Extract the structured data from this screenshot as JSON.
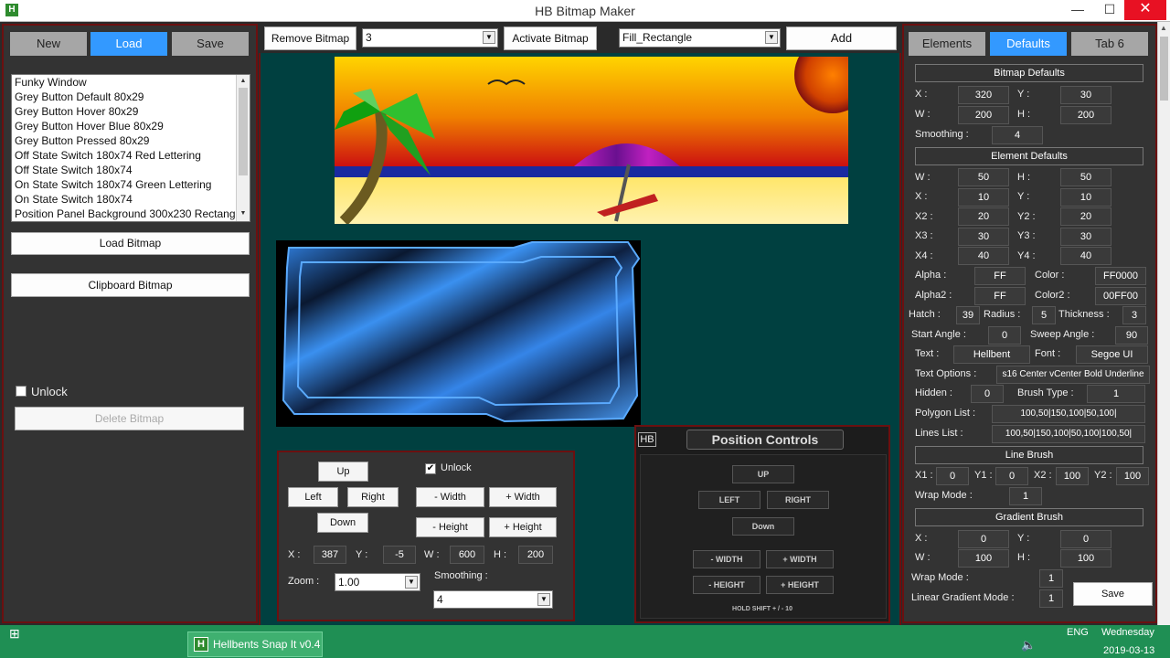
{
  "window": {
    "title": "HB Bitmap Maker",
    "app_icon": "H",
    "minimize": "—",
    "maximize": "☐",
    "close": "✕"
  },
  "toolbar_left": {
    "new": "New",
    "load": "Load",
    "save": "Save"
  },
  "bitmap_list": [
    "Funky Window",
    "Grey Button Default 80x29",
    "Grey Button Hover 80x29",
    "Grey Button Hover Blue 80x29",
    "Grey Button Pressed 80x29",
    "Off State Switch 180x74 Red Lettering",
    "Off State Switch 180x74",
    "On State Switch 180x74 Green Lettering",
    "On State Switch 180x74",
    "Position Panel Background 300x230 Rectang"
  ],
  "left_panel": {
    "load_bitmap": "Load Bitmap",
    "clipboard_bitmap": "Clipboard Bitmap",
    "unlock": "Unlock",
    "delete_bitmap": "Delete Bitmap"
  },
  "top_bar": {
    "remove_bitmap": "Remove Bitmap",
    "index_value": "3",
    "activate_bitmap": "Activate Bitmap",
    "element_type": "Fill_Rectangle",
    "add": "Add"
  },
  "controls": {
    "up": "Up",
    "left": "Left",
    "right": "Right",
    "down": "Down",
    "unlock": "Unlock",
    "minus_width": "- Width",
    "plus_width": "+ Width",
    "minus_height": "- Height",
    "plus_height": "+ Height",
    "x_label": "X :",
    "x": "387",
    "y_label": "Y :",
    "y": "-5",
    "w_label": "W :",
    "w": "600",
    "h_label": "H :",
    "h": "200",
    "zoom_label": "Zoom :",
    "zoom": "1.00",
    "smoothing_label": "Smoothing :",
    "smoothing": "4"
  },
  "position_controls": {
    "hb": "HB",
    "title": "Position Controls",
    "up": "UP",
    "left": "LEFT",
    "right": "RIGHT",
    "down": "Down",
    "minus_width": "- WIDTH",
    "plus_width": "+ WIDTH",
    "minus_height": "- HEIGHT",
    "plus_height": "+ HEIGHT",
    "hint": "HOLD SHIFT + / - 10"
  },
  "right_tabs": {
    "elements": "Elements",
    "defaults": "Defaults",
    "tab6": "Tab 6"
  },
  "defaults": {
    "bitmap_defaults": "Bitmap Defaults",
    "bx_l": "X :",
    "bx": "320",
    "by_l": "Y :",
    "by": "30",
    "bw_l": "W :",
    "bw": "200",
    "bh_l": "H :",
    "bh": "200",
    "smooth_l": "Smoothing :",
    "smooth": "4",
    "element_defaults": "Element Defaults",
    "ew_l": "W :",
    "ew": "50",
    "eh_l": "H :",
    "eh": "50",
    "ex_l": "X :",
    "ex": "10",
    "ey_l": "Y :",
    "ey": "10",
    "x2_l": "X2 :",
    "x2": "20",
    "y2_l": "Y2 :",
    "y2": "20",
    "x3_l": "X3 :",
    "x3": "30",
    "y3_l": "Y3 :",
    "y3": "30",
    "x4_l": "X4 :",
    "x4": "40",
    "y4_l": "Y4 :",
    "y4": "40",
    "alpha_l": "Alpha :",
    "alpha": "FF",
    "color_l": "Color :",
    "color": "FF0000",
    "alpha2_l": "Alpha2 :",
    "alpha2": "FF",
    "color2_l": "Color2 :",
    "color2": "00FF00",
    "hatch_l": "Hatch :",
    "hatch": "39",
    "radius_l": "Radius :",
    "radius": "5",
    "thick_l": "Thickness :",
    "thick": "3",
    "start_l": "Start Angle :",
    "start": "0",
    "sweep_l": "Sweep Angle :",
    "sweep": "90",
    "text_l": "Text :",
    "text": "Hellbent",
    "font_l": "Font :",
    "font": "Segoe UI",
    "topt_l": "Text Options :",
    "topt": "s16 Center vCenter Bold Underline",
    "hidden_l": "Hidden :",
    "hidden": "0",
    "brush_l": "Brush Type :",
    "brush": "1",
    "poly_l": "Polygon List :",
    "poly": "100,50|150,100|50,100|",
    "lines_l": "Lines List :",
    "lines": "100,50|150,100|50,100|100,50|",
    "line_brush": "Line Brush",
    "lx1_l": "X1 :",
    "lx1": "0",
    "ly1_l": "Y1 :",
    "ly1": "0",
    "lx2_l": "X2 :",
    "lx2": "100",
    "ly2_l": "Y2 :",
    "ly2": "100",
    "wrap_l": "Wrap Mode :",
    "wrap": "1",
    "gradient_brush": "Gradient Brush",
    "gx_l": "X :",
    "gx": "0",
    "gy_l": "Y :",
    "gy": "0",
    "gw_l": "W :",
    "gw": "100",
    "gh_l": "H :",
    "gh": "100",
    "gwrap_l": "Wrap Mode :",
    "gwrap": "1",
    "lgm_l": "Linear Gradient Mode :",
    "lgm": "1",
    "save": "Save"
  },
  "taskbar": {
    "app": "Hellbents Snap It v0.4",
    "lang": "ENG",
    "day": "Wednesday",
    "date": "2019-03-13"
  },
  "colors": {
    "accent": "#3399ff",
    "frame": "#6b1010",
    "canvas": "#004040",
    "taskbar": "#1f8f54"
  }
}
